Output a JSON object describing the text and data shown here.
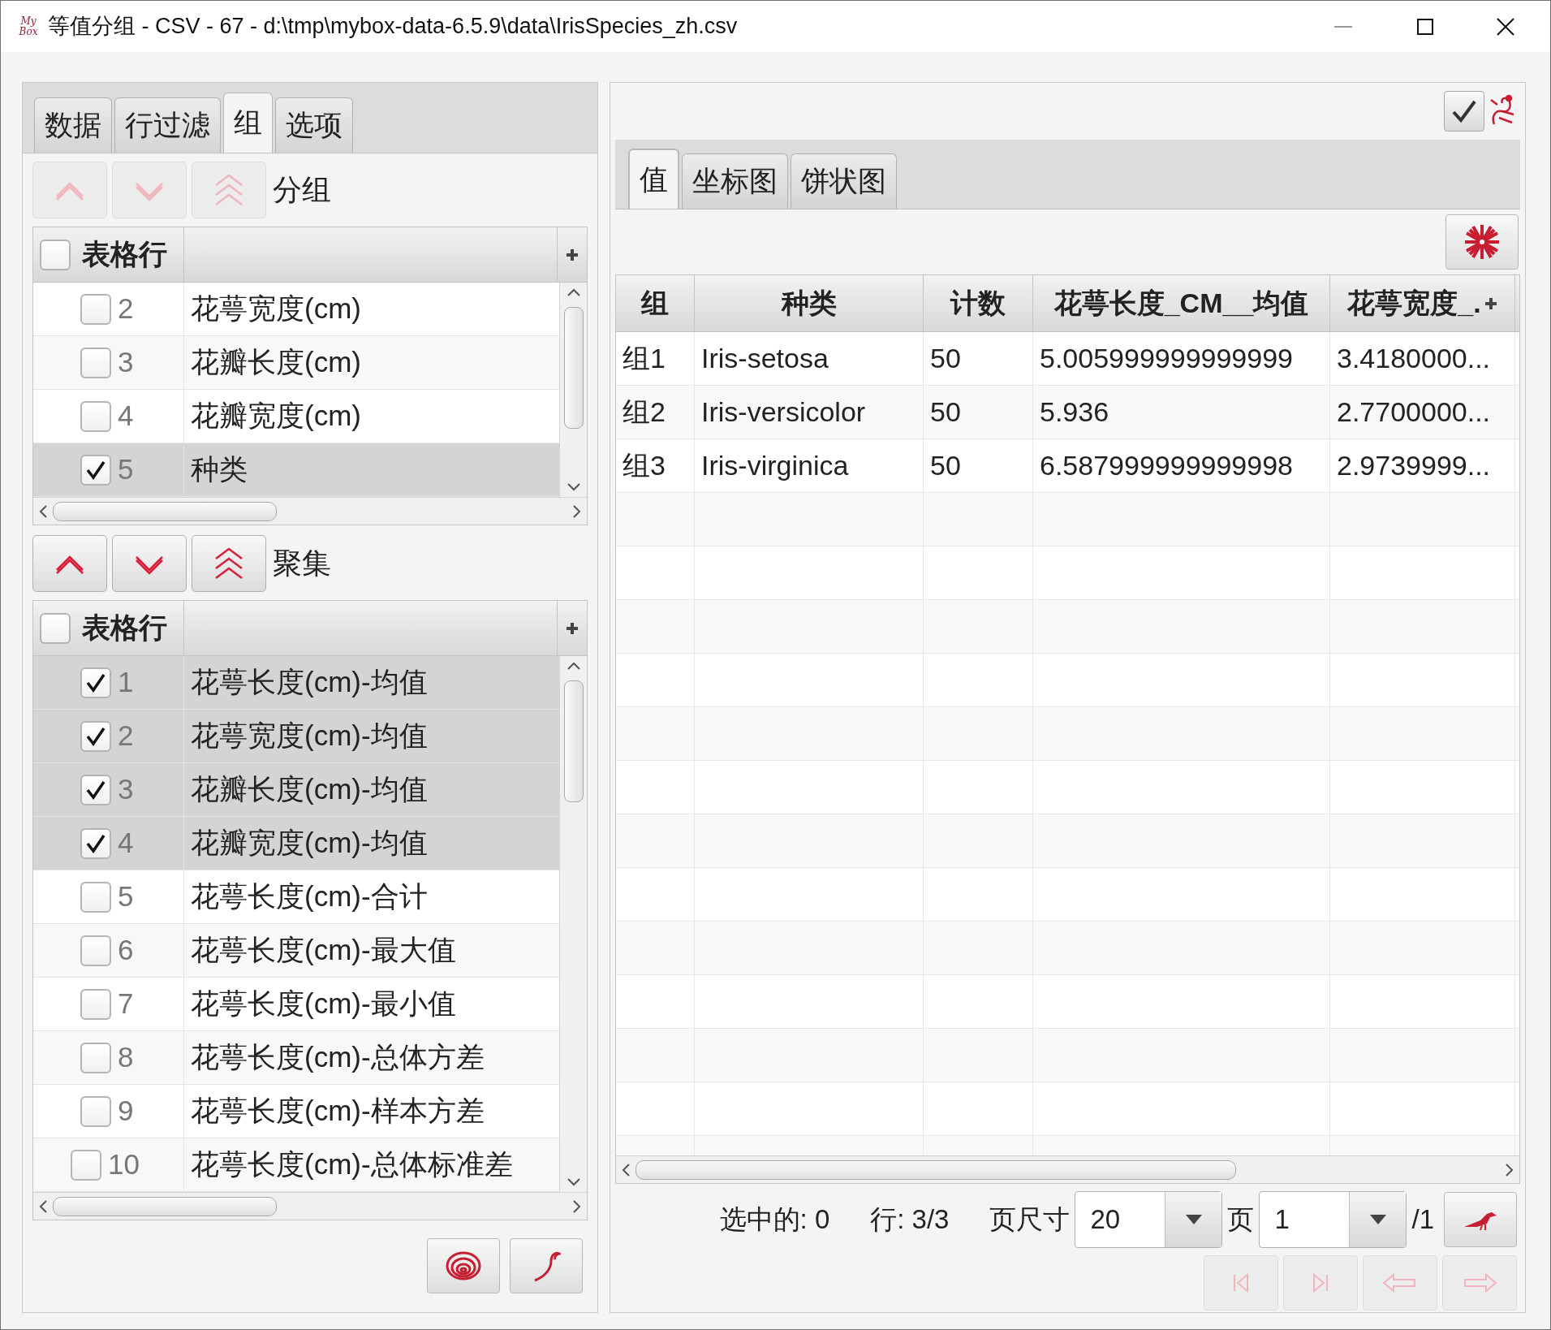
{
  "window": {
    "logo_text": [
      "My",
      "Box"
    ],
    "title": "等值分组 - CSV - 67 - d:\\tmp\\mybox-data-6.5.9\\data\\IrisSpecies_zh.csv"
  },
  "left_tabs": [
    {
      "label": "数据",
      "selected": false
    },
    {
      "label": "行过滤",
      "selected": false
    },
    {
      "label": "组",
      "selected": true
    },
    {
      "label": "选项",
      "selected": false
    }
  ],
  "group_section": {
    "label": "分组",
    "disabled": true,
    "header": "表格行",
    "header_checked": false,
    "rows": [
      {
        "index": "2",
        "name": "花萼宽度(cm)",
        "checked": false
      },
      {
        "index": "3",
        "name": "花瓣长度(cm)",
        "checked": false
      },
      {
        "index": "4",
        "name": "花瓣宽度(cm)",
        "checked": false
      },
      {
        "index": "5",
        "name": "种类",
        "checked": true
      }
    ]
  },
  "aggregate_section": {
    "label": "聚集",
    "disabled": false,
    "header": "表格行",
    "header_checked": false,
    "rows": [
      {
        "index": "1",
        "name": "花萼长度(cm)-均值",
        "checked": true
      },
      {
        "index": "2",
        "name": "花萼宽度(cm)-均值",
        "checked": true
      },
      {
        "index": "3",
        "name": "花瓣长度(cm)-均值",
        "checked": true
      },
      {
        "index": "4",
        "name": "花瓣宽度(cm)-均值",
        "checked": true
      },
      {
        "index": "5",
        "name": "花萼长度(cm)-合计",
        "checked": false
      },
      {
        "index": "6",
        "name": "花萼长度(cm)-最大值",
        "checked": false
      },
      {
        "index": "7",
        "name": "花萼长度(cm)-最小值",
        "checked": false
      },
      {
        "index": "8",
        "name": "花萼长度(cm)-总体方差",
        "checked": false
      },
      {
        "index": "9",
        "name": "花萼长度(cm)-样本方差",
        "checked": false
      },
      {
        "index": "10",
        "name": "花萼长度(cm)-总体标准差",
        "checked": false
      }
    ]
  },
  "right_tabs": [
    {
      "label": "值",
      "selected": true
    },
    {
      "label": "坐标图",
      "selected": false
    },
    {
      "label": "饼状图",
      "selected": false
    }
  ],
  "table": {
    "columns": [
      "组",
      "种类",
      "计数",
      "花萼长度_CM__均值",
      "花萼宽度_."
    ],
    "rows": [
      [
        "组1",
        "Iris-setosa",
        "50",
        "5.005999999999999",
        "3.4180000..."
      ],
      [
        "组2",
        "Iris-versicolor",
        "50",
        "5.936",
        "2.7700000..."
      ],
      [
        "组3",
        "Iris-virginica",
        "50",
        "6.587999999999998",
        "2.9739999..."
      ]
    ]
  },
  "footer": {
    "selected": "选中的: 0",
    "rows": "行: 3/3",
    "page_size_label": "页尺寸",
    "page_size": "20",
    "page_label": "页",
    "page": "1",
    "page_total": "/1",
    "nav_disabled": true
  }
}
